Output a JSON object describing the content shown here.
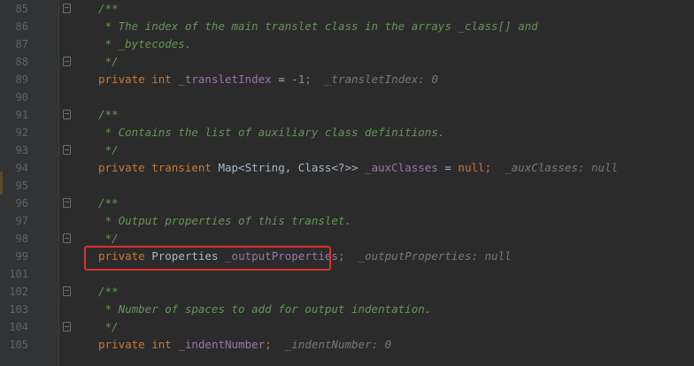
{
  "lines": [
    {
      "num": "85",
      "text": "/**"
    },
    {
      "num": "86",
      "text": " * The index of the main translet class in the arrays _class[] and"
    },
    {
      "num": "87",
      "text": " * _bytecodes."
    },
    {
      "num": "88",
      "text": " */"
    },
    {
      "num": "89",
      "kw": "private int ",
      "field": "_transletIndex",
      "rest1": " = ",
      "number": "-1",
      "rest2": ";",
      "hint": "_transletIndex: 0"
    },
    {
      "num": "90"
    },
    {
      "num": "91",
      "text": "/**"
    },
    {
      "num": "92",
      "text": " * Contains the list of auxiliary class definitions."
    },
    {
      "num": "93",
      "text": " */"
    },
    {
      "num": "94",
      "kw": "private transient ",
      "type": "Map<String, Class<?>> ",
      "field": "_auxClasses",
      "rest1": " = ",
      "kw2": "null",
      "rest2": ";",
      "hint": "_auxClasses: null"
    },
    {
      "num": "95"
    },
    {
      "num": "96",
      "text": "/**"
    },
    {
      "num": "97",
      "text": " * Output properties of this translet."
    },
    {
      "num": "98",
      "text": " */"
    },
    {
      "num": "99",
      "kw": "private ",
      "type": "Properties ",
      "field": "_outputProperties",
      "rest2": ";",
      "hint": "_outputProperties: null"
    },
    {
      "num": "101"
    },
    {
      "num": "102",
      "text": "/**"
    },
    {
      "num": "103",
      "text": " * Number of spaces to add for output indentation."
    },
    {
      "num": "104",
      "text": " */"
    },
    {
      "num": "105",
      "kw": "private int ",
      "field": "_indentNumber",
      "rest2": ";",
      "hint": "_indentNumber: 0"
    }
  ],
  "line_numbers": [
    "85",
    "86",
    "87",
    "88",
    "89",
    "90",
    "91",
    "92",
    "93",
    "94",
    "95",
    "96",
    "97",
    "98",
    "99",
    "101",
    "102",
    "103",
    "104",
    "105"
  ]
}
